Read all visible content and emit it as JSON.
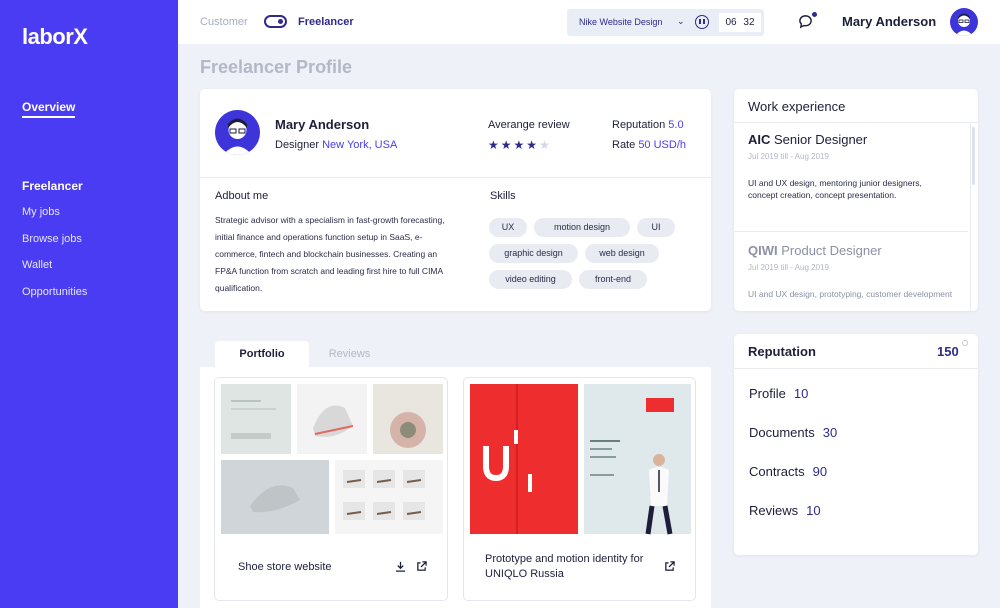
{
  "brand": {
    "logo": "laborX",
    "sidebar_color": "#4a3cf2",
    "accent": "#2f2a8e"
  },
  "sidebar": {
    "overview": "Overview",
    "group_title": "Freelancer",
    "items": [
      {
        "label": "My jobs"
      },
      {
        "label": "Browse jobs"
      },
      {
        "label": "Wallet"
      },
      {
        "label": "Opportunities"
      }
    ]
  },
  "header": {
    "role_customer": "Customer",
    "role_freelancer": "Freelancer",
    "project": "Nike Website Design",
    "timer_hours": "06",
    "timer_minutes": "32",
    "user_name": "Mary Anderson"
  },
  "page_title": "Freelancer Profile",
  "profile": {
    "name": "Mary Anderson",
    "role": "Designer",
    "location": "New York, USA",
    "review_label": "Averange review",
    "rating": 4,
    "rating_max": 5,
    "reputation_label": "Reputation",
    "reputation_value": "5.0",
    "rate_label": "Rate",
    "rate_value": "50 USD/h",
    "about_title": "Adbout me",
    "about_text": "Strategic advisor with a specialism in fast-growth forecasting, initial finance and operations function setup in SaaS, e-commerce, fintech and blockchain businesses. Creating an FP&A function from scratch and leading first hire to full CIMA qualification.",
    "skills_title": "Skills",
    "skills": [
      "UX",
      "motion design",
      "UI",
      "graphic design",
      "web design",
      "video editing",
      "front-end"
    ]
  },
  "work_experience": {
    "title": "Work experience",
    "jobs": [
      {
        "company": "AIC",
        "position": "Senior Designer",
        "dates": "Jul 2019 till - Aug 2019",
        "description": "UI and UX design, mentoring junior designers, concept creation, concept presentation."
      },
      {
        "company": "QIWI",
        "position": "Product Designer",
        "dates": "Jul 2019 till - Aug 2019",
        "description": "UI and UX design, prototyping, customer development"
      }
    ]
  },
  "portfolio": {
    "tabs": [
      "Portfolio",
      "Reviews"
    ],
    "items": [
      {
        "label": "Shoe store website"
      },
      {
        "label": "Prototype and motion identity for UNIQLO Russia"
      }
    ]
  },
  "reputation": {
    "title": "Reputation",
    "total": "150",
    "rows": [
      {
        "label": "Profile",
        "value": "10"
      },
      {
        "label": "Documents",
        "value": "30"
      },
      {
        "label": "Contracts",
        "value": "90"
      },
      {
        "label": "Reviews",
        "value": "10"
      }
    ]
  }
}
